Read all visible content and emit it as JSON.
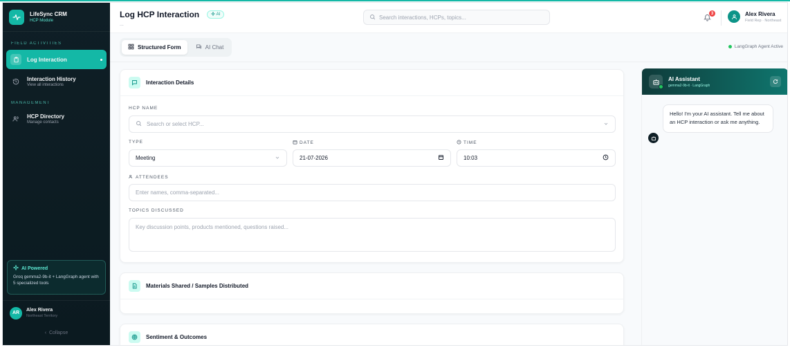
{
  "brand": {
    "title": "LifeSync CRM",
    "subtitle": "HCP Module"
  },
  "sidebar": {
    "section_field": "FIELD ACTIVITIES",
    "section_management": "MANAGEMENT",
    "items": [
      {
        "label": "Log Interaction",
        "sub": ""
      },
      {
        "label": "Interaction History",
        "sub": "View all interactions"
      },
      {
        "label": "HCP Directory",
        "sub": "Manage contacts"
      }
    ],
    "ai_card": {
      "title": "AI Powered",
      "text": "Groq gemma2-9b-it + LangGraph agent with 5 specialized tools"
    },
    "user": {
      "initials": "AR",
      "name": "Alex Rivera",
      "territory": "Northeast Territory"
    },
    "collapse_label": "Collapse"
  },
  "header": {
    "title": "Log HCP Interaction",
    "ai_chip": "AI",
    "sub": "...",
    "search_placeholder": "Search interactions, HCPs, topics...",
    "notifications": "3",
    "user_name": "Alex Rivera",
    "user_role": "Field Rep · Northeast"
  },
  "tabs": [
    {
      "label": "Structured Form"
    },
    {
      "label": "AI Chat"
    }
  ],
  "agent_status": "LangGraph Agent Active",
  "interaction_details": {
    "title": "Interaction Details",
    "hcp_label": "HCP NAME",
    "hcp_placeholder": "Search or select HCP...",
    "type_label": "TYPE",
    "type_value": "Meeting",
    "date_label": "DATE",
    "date_value": "21-07-2026",
    "time_label": "TIME",
    "time_value": "10:03",
    "attendees_label": "ATTENDEES",
    "attendees_placeholder": "Enter names, comma-separated...",
    "topics_label": "TOPICS DISCUSSED",
    "topics_placeholder": "Key discussion points, products mentioned, questions raised..."
  },
  "materials": {
    "title": "Materials Shared / Samples Distributed"
  },
  "sentiment": {
    "title": "Sentiment & Outcomes"
  },
  "assistant": {
    "title": "AI Assistant",
    "model": "gemma2-9b-it · LangGraph",
    "greeting": "Hello! I'm your AI assistant. Tell me about an HCP interaction or ask me anything."
  },
  "colors": {
    "accent": "#14b8a6",
    "sidebar_bg": "#0f1f26",
    "notification": "#ef4444"
  }
}
